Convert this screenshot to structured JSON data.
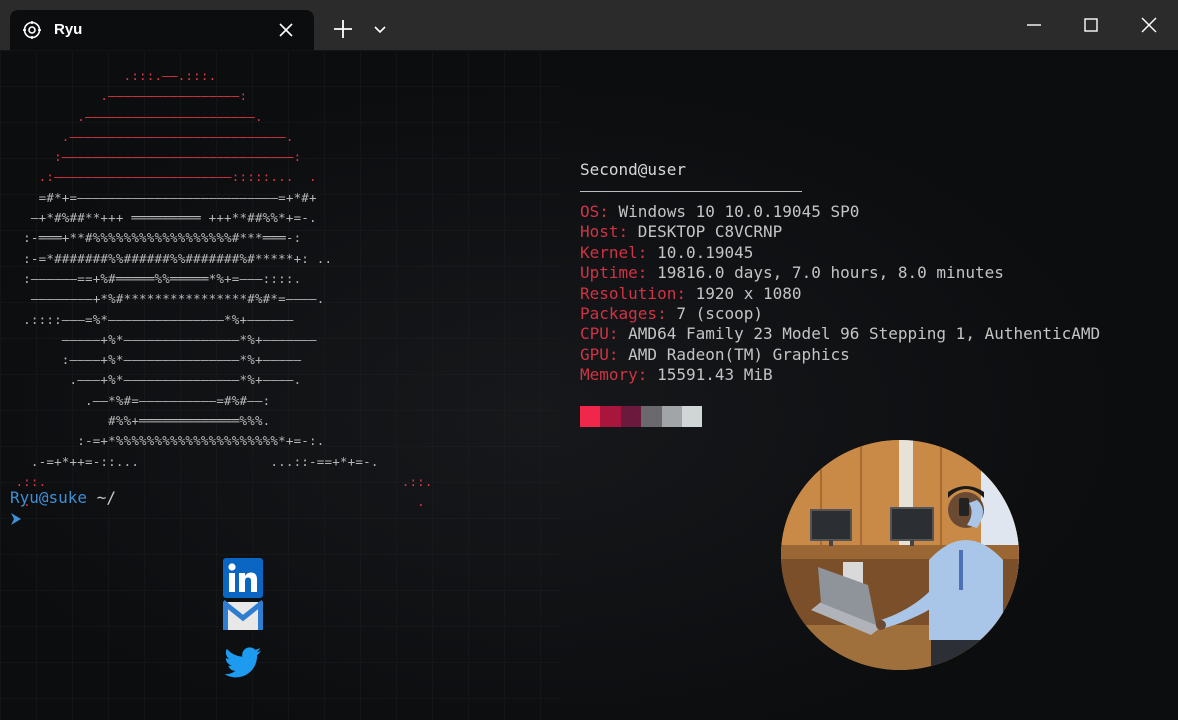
{
  "window": {
    "tab_title": "Ryu",
    "icons": {
      "tab": "gear-icon",
      "close_tab": "close-icon",
      "new_tab": "plus-icon",
      "dropdown": "chevron-down-icon",
      "minimize": "minimize-icon",
      "maximize": "maximize-icon",
      "close": "close-icon"
    }
  },
  "ascii_art": [
    "                .:::.——.:::.",
    "             .—————————————————:",
    "          .——————————————————————.",
    "        .————————————————————————————.",
    "       :——————————————————————————————:",
    "     .:———————————————————————:::::...  .",
    "     =#*+=——————————————————————————=+*#+",
    "    —+*#%##**+++ ═════════ +++**##%%*+=-.",
    "   :-═══+**#%%%%%%%%%%%%%%%%%%#***═══-:",
    "   :-=*#######%%######%%#######%#*****+: ..",
    "   :——————==+%#═════%%═════*%+=———::::.",
    "    ————————+*%#****************#%#*=————.",
    "   .::::———=%*———————————————*%+——————",
    "        —————+%*———————————————*%+———————",
    "        :————+%*———————————————*%+—————",
    "         .———+%*———————————————*%+————.",
    "           .——*%#=——————————=#%#——:",
    "              #%%+═════════════%%%.",
    "          :-=+*%%%%%%%%%%%%%%%%%%%%%*+=-:.",
    "    .-=+*++=-::...                 ...::-==+*+=-.",
    "  .::.                                              .::.",
    "   .                                                  ."
  ],
  "sysinfo": {
    "title": "Second@user",
    "rows": [
      {
        "key": "OS:",
        "value": " Windows 10 10.0.19045 SP0"
      },
      {
        "key": "Host:",
        "value": " DESKTOP C8VCRNP"
      },
      {
        "key": "Kernel:",
        "value": " 10.0.19045"
      },
      {
        "key": "Uptime:",
        "value": " 19816.0 days, 7.0 hours, 8.0 minutes"
      },
      {
        "key": "Resolution:",
        "value": " 1920 x 1080"
      },
      {
        "key": "Packages:",
        "value": " 7 (scoop)"
      },
      {
        "key": "CPU:",
        "value": " AMD64 Family 23 Model 96 Stepping 1, AuthenticAMD"
      },
      {
        "key": "GPU:",
        "value": " AMD Radeon(TM) Graphics"
      },
      {
        "key": "Memory:",
        "value": " 15591.43 MiB"
      }
    ],
    "palette": [
      "#f0264a",
      "#a8163e",
      "#6b1a3e",
      "#6a6a6e",
      "#a2a5a8",
      "#d0d6d6"
    ]
  },
  "prompt": {
    "user": "Ryu@suke",
    "path": " ~/",
    "cursor_icon": "chevron-right-icon"
  },
  "social": {
    "linkedin": "linkedin-icon",
    "mail": "mail-icon",
    "twitter": "twitter-icon"
  },
  "colors": {
    "accent_red": "#d03344",
    "prompt_blue": "#3d8fd6",
    "background": "#0c0d0f",
    "titlebar": "#2b2b2b"
  }
}
